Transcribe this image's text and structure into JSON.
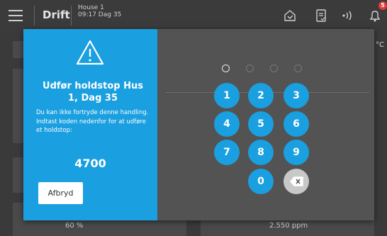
{
  "topbar": {
    "title": "Drift",
    "house_line1": "House 1",
    "house_line2": "09:17  Dag 35",
    "notification_count": "5",
    "icons": [
      "menu-icon",
      "house-icon",
      "document-icon",
      "signal-icon",
      "bell-icon"
    ]
  },
  "background": {
    "unit": "°C",
    "left_reading": "60 %",
    "right_reading": "2.550 ppm"
  },
  "dialog": {
    "title": "Udfør holdstop Hus 1, Dag 35",
    "desc_line1": "Du kan ikke fortryde denne handling.",
    "desc_line2": "Indtast koden nedenfor for at udføre et holdstop:",
    "code": "4700",
    "abort_label": "Afbryd",
    "pin_length": 4,
    "pin_entered": 0,
    "keys": [
      "1",
      "2",
      "3",
      "4",
      "5",
      "6",
      "7",
      "8",
      "9",
      "0"
    ]
  },
  "colors": {
    "accent": "#1a9fe0",
    "badge": "#e53935",
    "dialog_bg": "#535353"
  }
}
